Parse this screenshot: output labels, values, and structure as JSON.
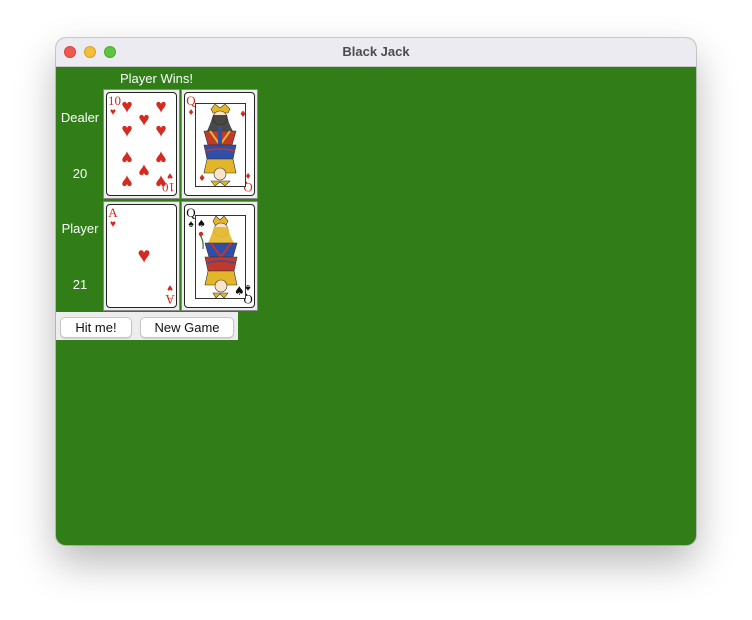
{
  "window": {
    "title": "Black Jack"
  },
  "status": "Player Wins!",
  "dealer": {
    "label": "Dealer",
    "score": "20",
    "cards": [
      {
        "rank": "10",
        "suit": "hearts",
        "suit_symbol": "♥"
      },
      {
        "rank": "Q",
        "suit": "diamonds",
        "suit_symbol": "♦"
      }
    ]
  },
  "player": {
    "label": "Player",
    "score": "21",
    "cards": [
      {
        "rank": "A",
        "suit": "hearts",
        "suit_symbol": "♥"
      },
      {
        "rank": "Q",
        "suit": "spades",
        "suit_symbol": "♠"
      }
    ]
  },
  "buttons": {
    "hit": "Hit me!",
    "new_game": "New Game"
  },
  "colors": {
    "table_green": "#317e18",
    "red_suit": "#d42a1f",
    "black_suit": "#111111"
  }
}
